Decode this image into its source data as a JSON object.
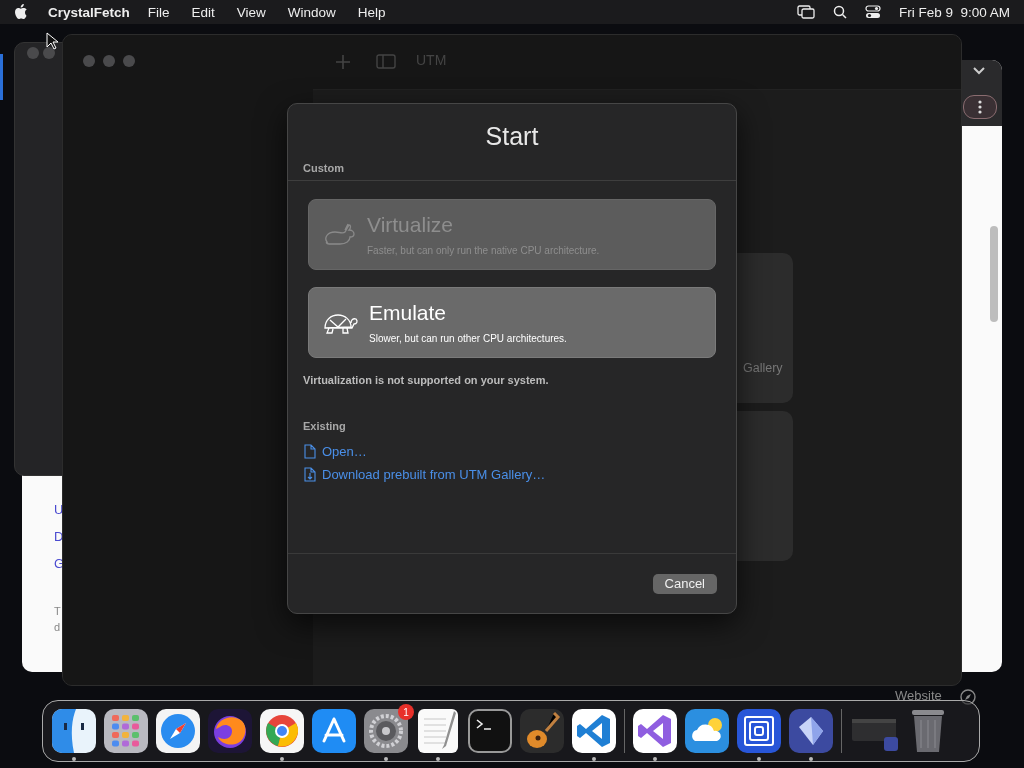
{
  "menu_bar": {
    "app_name": "CrystalFetch",
    "menus": [
      "File",
      "Edit",
      "View",
      "Window",
      "Help"
    ],
    "clock": "Fri Feb 9  9:00 AM"
  },
  "background": {
    "letters": [
      {
        "text": "U",
        "kind": "link"
      },
      {
        "text": "D",
        "kind": "link"
      },
      {
        "text": "G",
        "kind": "link"
      },
      {
        "text": "T",
        "kind": "plain"
      },
      {
        "text": "d",
        "kind": "plain"
      }
    ],
    "gallery_text": "Gallery",
    "website_label": "Website"
  },
  "utm_window": {
    "title": "UTM"
  },
  "dialog": {
    "title": "Start",
    "custom_label": "Custom",
    "options": [
      {
        "kind": "virtualize",
        "title": "Virtualize",
        "subtitle": "Faster, but can only run the native CPU architecture.",
        "disabled": true
      },
      {
        "kind": "emulate",
        "title": "Emulate",
        "subtitle": "Slower, but can run other CPU architectures.",
        "disabled": false
      }
    ],
    "note": "Virtualization is not supported on your system.",
    "existing_label": "Existing",
    "links": [
      {
        "kind": "open",
        "label": "Open…"
      },
      {
        "kind": "download",
        "label": "Download prebuilt from UTM Gallery…"
      }
    ],
    "cancel": "Cancel"
  },
  "dock": {
    "items": [
      {
        "running": true
      },
      {
        "running": false
      },
      {
        "running": false
      },
      {
        "running": false
      },
      {
        "running": true
      },
      {
        "running": false
      },
      {
        "running": true,
        "badge": "1"
      },
      {
        "running": true
      },
      {
        "running": false
      },
      {
        "running": false
      },
      {
        "running": true
      },
      {
        "running": true
      },
      {
        "running": false
      },
      {
        "running": true
      },
      {
        "running": true
      }
    ]
  }
}
